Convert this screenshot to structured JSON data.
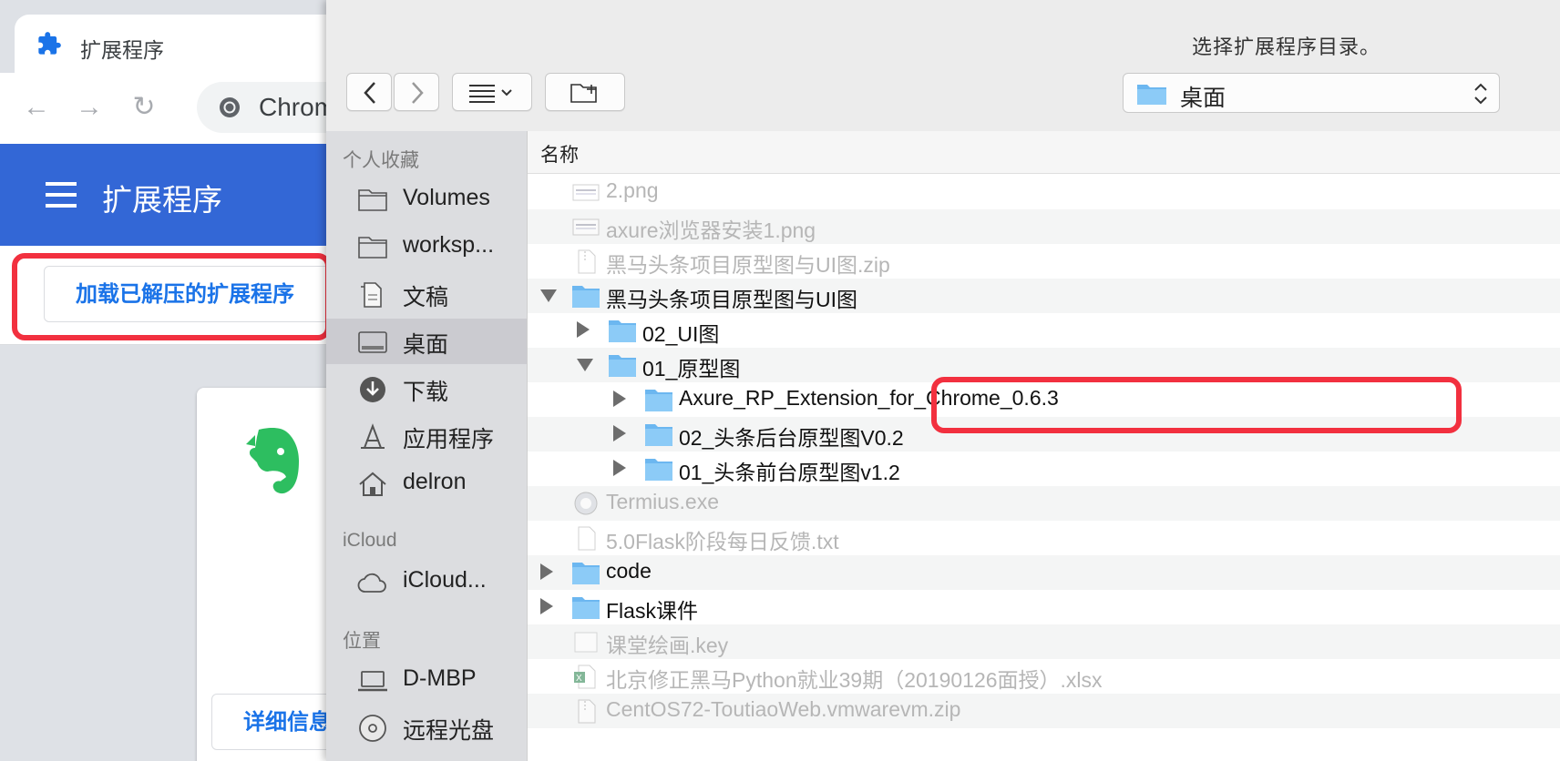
{
  "browser": {
    "tab_title": "扩展程序",
    "omnibox_text": "Chrome",
    "ext_header_title": "扩展程序",
    "load_unpacked_label": "加载已解压的扩展程序",
    "details_label": "详细信息",
    "accent_color": "#3367d6",
    "highlight_color": "#f2303f"
  },
  "dialog": {
    "title": "选择扩展程序目录。",
    "location": "桌面",
    "column_name": "名称",
    "sidebar": {
      "favorites_header": "个人收藏",
      "favorites": [
        {
          "label": "Volumes",
          "icon": "folder-icon"
        },
        {
          "label": "worksp...",
          "icon": "folder-icon"
        },
        {
          "label": "文稿",
          "icon": "documents-icon"
        },
        {
          "label": "桌面",
          "icon": "desktop-icon",
          "selected": true
        },
        {
          "label": "下载",
          "icon": "download-icon"
        },
        {
          "label": "应用程序",
          "icon": "applications-icon"
        },
        {
          "label": "delron",
          "icon": "home-icon"
        }
      ],
      "icloud_header": "iCloud",
      "icloud": [
        {
          "label": "iCloud...",
          "icon": "cloud-icon"
        }
      ],
      "locations_header": "位置",
      "locations": [
        {
          "label": "D-MBP",
          "icon": "laptop-icon"
        },
        {
          "label": "远程光盘",
          "icon": "disc-icon"
        }
      ]
    },
    "files": [
      {
        "name": "2.png",
        "level": 0,
        "type": "image",
        "disclosure": "none",
        "enabled": false
      },
      {
        "name": "axure浏览器安装1.png",
        "level": 0,
        "type": "image",
        "disclosure": "none",
        "enabled": false
      },
      {
        "name": "黑马头条项目原型图与UI图.zip",
        "level": 0,
        "type": "zip",
        "disclosure": "none",
        "enabled": false
      },
      {
        "name": "黑马头条项目原型图与UI图",
        "level": 0,
        "type": "folder",
        "disclosure": "open",
        "enabled": true
      },
      {
        "name": "02_UI图",
        "level": 1,
        "type": "folder",
        "disclosure": "closed",
        "enabled": true
      },
      {
        "name": "01_原型图",
        "level": 1,
        "type": "folder",
        "disclosure": "open",
        "enabled": true
      },
      {
        "name": "Axure_RP_Extension_for_Chrome_0.6.3",
        "level": 2,
        "type": "folder",
        "disclosure": "closed",
        "enabled": true
      },
      {
        "name": "02_头条后台原型图V0.2",
        "level": 2,
        "type": "folder",
        "disclosure": "closed",
        "enabled": true
      },
      {
        "name": "01_头条前台原型图v1.2",
        "level": 2,
        "type": "folder",
        "disclosure": "closed",
        "enabled": true
      },
      {
        "name": "Termius.exe",
        "level": 0,
        "type": "exe",
        "disclosure": "none",
        "enabled": false
      },
      {
        "name": "5.0Flask阶段每日反馈.txt",
        "level": 0,
        "type": "text",
        "disclosure": "none",
        "enabled": false
      },
      {
        "name": "code",
        "level": 0,
        "type": "folder",
        "disclosure": "closed",
        "enabled": true
      },
      {
        "name": "Flask课件",
        "level": 0,
        "type": "folder",
        "disclosure": "closed",
        "enabled": true
      },
      {
        "name": "课堂绘画.key",
        "level": 0,
        "type": "key",
        "disclosure": "none",
        "enabled": false
      },
      {
        "name": "北京修正黑马Python就业39期（20190126面授）.xlsx",
        "level": 0,
        "type": "excel",
        "disclosure": "none",
        "enabled": false
      },
      {
        "name": "CentOS72-ToutiaoWeb.vmwarevm.zip",
        "level": 0,
        "type": "zip",
        "disclosure": "none",
        "enabled": false
      }
    ]
  }
}
